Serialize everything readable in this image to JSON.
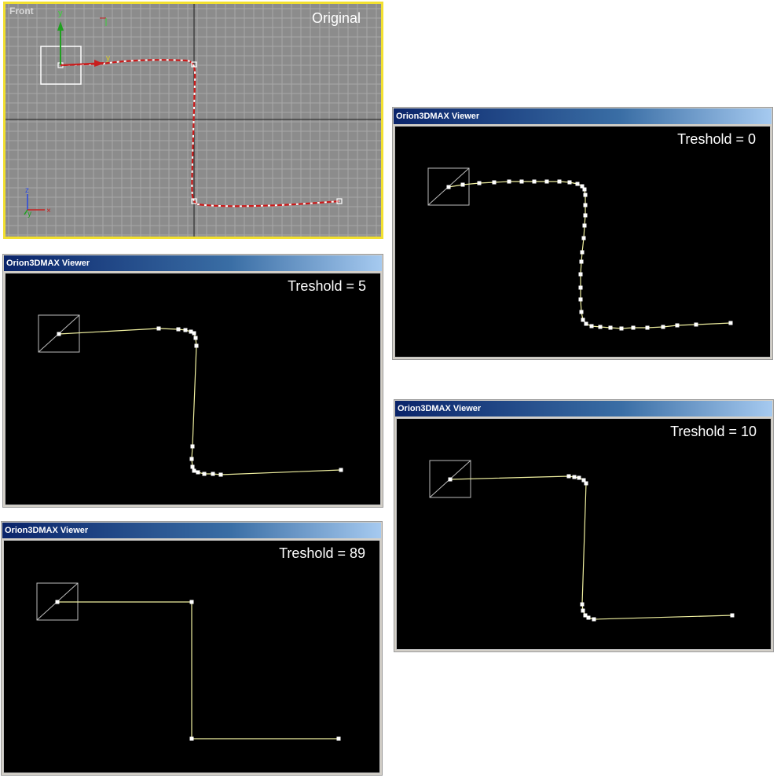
{
  "viewport": {
    "label": "Front",
    "caption": "Original",
    "axis_y": "y",
    "axis_z": "z"
  },
  "viewers": [
    {
      "title": "Orion3DMAX Viewer",
      "caption": "Treshold = 0"
    },
    {
      "title": "Orion3DMAX Viewer",
      "caption": "Treshold = 5"
    },
    {
      "title": "Orion3DMAX Viewer",
      "caption": "Treshold = 10"
    },
    {
      "title": "Orion3DMAX Viewer",
      "caption": "Treshold = 89"
    }
  ],
  "colors": {
    "viewport_bg": "#8c8c8c",
    "grid": "#a8a8a8",
    "viewport_border": "#f2e030",
    "path_red": "#cc1a1a",
    "path_white": "#ffffff",
    "viewer_path": "#f0f0a0",
    "viewer_bg": "#000000"
  }
}
